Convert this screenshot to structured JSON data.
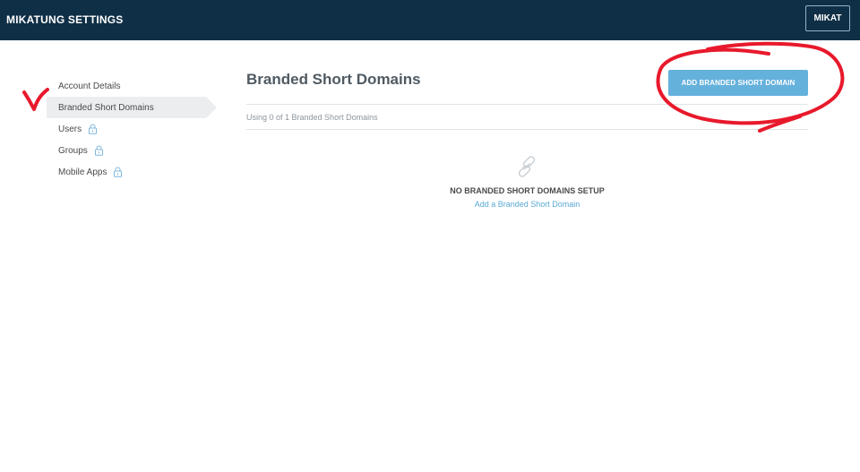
{
  "header": {
    "title": "MIKATUNG SETTINGS",
    "user_button": "MIKAT"
  },
  "sidebar": {
    "items": [
      {
        "label": "Account Details",
        "locked": false,
        "active": false
      },
      {
        "label": "Branded Short Domains",
        "locked": false,
        "active": true
      },
      {
        "label": "Users",
        "locked": true,
        "active": false
      },
      {
        "label": "Groups",
        "locked": true,
        "active": false
      },
      {
        "label": "Mobile Apps",
        "locked": true,
        "active": false
      }
    ]
  },
  "main": {
    "title": "Branded Short Domains",
    "add_button": "ADD BRANDED SHORT DOMAIN",
    "usage": "Using 0 of 1 Branded Short Domains",
    "empty_title": "NO BRANDED SHORT DOMAINS SETUP",
    "empty_link": "Add a Branded Short Domain",
    "empty_icon": "link-icon"
  },
  "colors": {
    "header_bg": "#0f2f46",
    "accent": "#64b1dc",
    "link": "#5aa9d6",
    "annotation": "#e8192c"
  },
  "icons": {
    "lock": "lock-icon"
  }
}
